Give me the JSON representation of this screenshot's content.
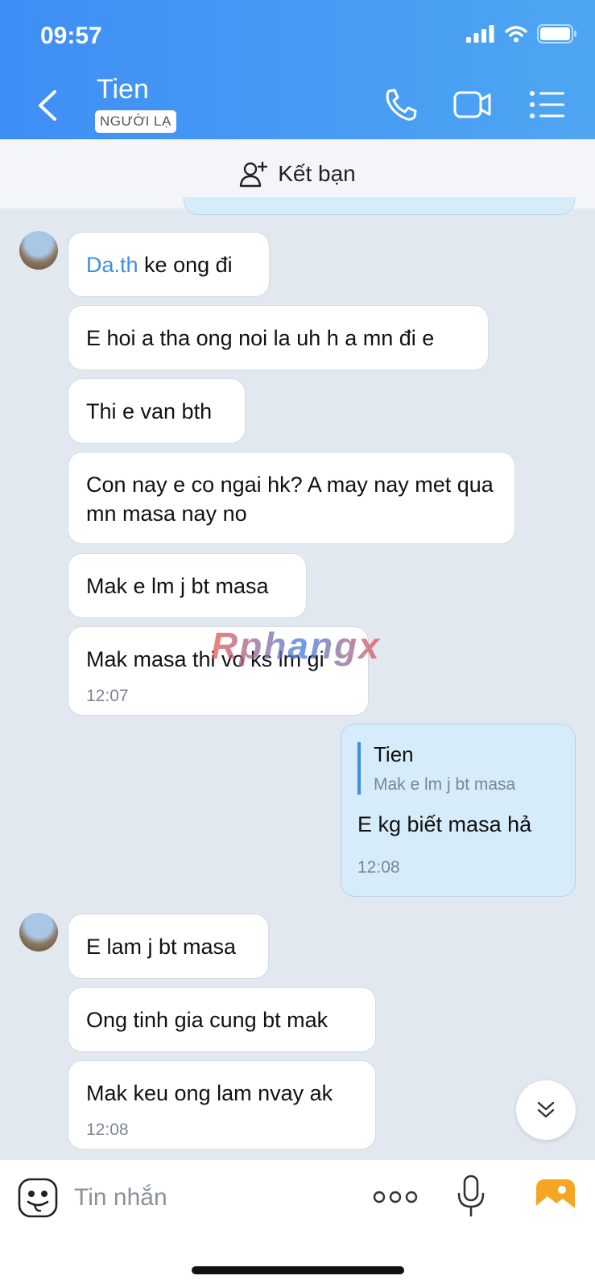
{
  "status_bar": {
    "time": "09:57"
  },
  "header": {
    "contact_name": "Tien",
    "badge": "NGƯỜI LẠ"
  },
  "add_friend": {
    "label": "Kết bạn"
  },
  "messages_in_1": [
    {
      "mention": "Da.th",
      "text": " ke ong đi"
    },
    {
      "text": "E hoi a tha ong noi la uh h a mn đi e"
    },
    {
      "text": "Thi e van bth"
    },
    {
      "text": "Con nay e co ngai hk? A may nay met qua mn masa nay no"
    },
    {
      "text": "Mak e lm j bt masa"
    },
    {
      "text": "Mak masa thi vo ks lm gi",
      "time": "12:07"
    }
  ],
  "message_out": {
    "quote_name": "Tien",
    "quote_text": "Mak e lm j bt masa",
    "text": "E kg biết masa hả",
    "time": "12:08"
  },
  "messages_in_2": [
    {
      "text": "E lam j bt masa"
    },
    {
      "text": "Ong tinh gia cung bt mak"
    },
    {
      "text": "Mak keu ong lam nvay ak",
      "time": "12:08"
    }
  ],
  "watermark": "Rphangx",
  "composer": {
    "placeholder": "Tin nhắn"
  },
  "colors": {
    "header_start": "#3e8ef5",
    "header_end": "#4ea6f2",
    "outgoing_bubble": "#d6ecfb",
    "mention": "#3b8ee6",
    "photo_icon": "#f5a623"
  },
  "icons": {
    "back": "chevron-left-icon",
    "call": "phone-icon",
    "video": "video-camera-icon",
    "menu": "list-menu-icon",
    "add_friend": "add-user-icon",
    "scroll": "double-chevron-down-icon",
    "emoji": "emoji-icon",
    "more": "more-dots-icon",
    "mic": "microphone-icon",
    "photo": "photo-icon"
  }
}
